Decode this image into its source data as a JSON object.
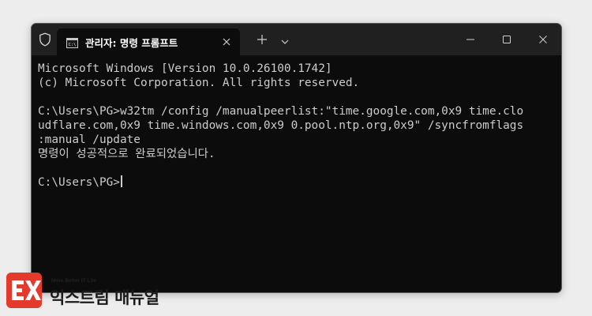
{
  "window": {
    "tab_title": "관리자: 명령 프롬프트"
  },
  "icons": {
    "shield": "shield-icon",
    "tab": "terminal-icon",
    "tab_close": "close-icon",
    "new_tab": "plus-icon",
    "dropdown": "chevron-down-icon",
    "minimize": "minimize-icon",
    "maximize": "maximize-icon",
    "close": "close-icon"
  },
  "console": {
    "lines": [
      "Microsoft Windows [Version 10.0.26100.1742]",
      "(c) Microsoft Corporation. All rights reserved.",
      "",
      "C:\\Users\\PG>w32tm /config /manualpeerlist:\"time.google.com,0x9 time.clo",
      "udflare.com,0x9 time.windows.com,0x9 0.pool.ntp.org,0x9\" /syncfromflags",
      ":manual /update",
      "명령이 성공적으로 완료되었습니다.",
      "",
      "C:\\Users\\PG>"
    ]
  },
  "watermark": {
    "tagline": "More Better IT Life",
    "name": "익스트림 매뉴얼"
  },
  "colors": {
    "console_bg": "#0c0c0c",
    "titlebar_bg": "#202020",
    "text": "#cccccc",
    "logo_red": "#e23b2e"
  }
}
